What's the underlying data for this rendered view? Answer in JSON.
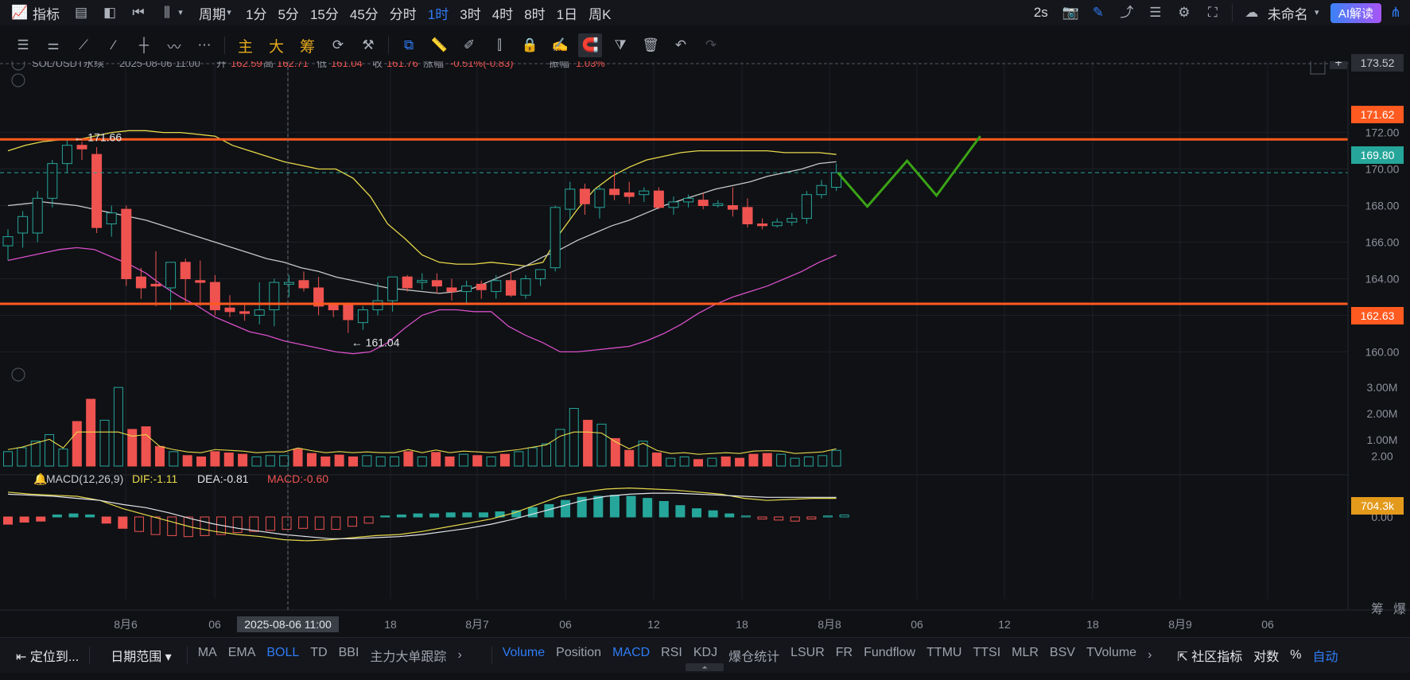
{
  "topbar": {
    "indicator_label": "指标",
    "period_label": "周期",
    "intervals": [
      "1分",
      "5分",
      "15分",
      "45分",
      "分时",
      "1时",
      "3时",
      "4时",
      "8时",
      "1日",
      "周K"
    ],
    "active_interval": "1时",
    "refresh": "2s",
    "layout_name": "未命名",
    "ai_label": "AI解读"
  },
  "drawbar": {
    "main_label": "主",
    "big_label": "大",
    "chip_label": "筹"
  },
  "legend": {
    "symbol": "SOL/USDT永续",
    "datetime": "2025-08-06 11:00",
    "open_label": "开",
    "open": "162.59",
    "high_label": "高",
    "high": "162.71",
    "low_label": "低",
    "low": "161.04",
    "close_label": "收",
    "close": "161.76",
    "change_label": "涨幅",
    "change": "-0.51%(-0.83)",
    "amp_label": "振幅",
    "amp": "1.03%"
  },
  "macd_legend": {
    "name": "MACD(12,26,9)",
    "dif": "DIF:-1.11",
    "dea": "DEA:-0.81",
    "macd": "MACD:-0.60"
  },
  "annotations": {
    "high_mark": "171.66",
    "low_mark": "161.04",
    "crosshair_time": "2025-08-06 11:00"
  },
  "price_tags": {
    "top": "173.52",
    "resistance": "171.62",
    "current": "169.80",
    "support": "162.63",
    "volume": "704.3k"
  },
  "colors": {
    "up": "#26a69a",
    "down": "#ef5350",
    "resistance": "#ff5a1f",
    "projection": "#3ba316",
    "boll_upper": "#e8d94a",
    "boll_mid": "#c8c8c8",
    "boll_lower": "#d94fc8",
    "current": "#26a69a",
    "volume_tag": "#e39a1b"
  },
  "axis": {
    "bottom_right": [
      "筹",
      "爆"
    ]
  },
  "bottombar": {
    "locate": "定位到...",
    "date_range": "日期范围",
    "main_indicators": [
      "MA",
      "EMA",
      "BOLL",
      "TD",
      "BBI",
      "主力大单跟踪"
    ],
    "active_main": "BOLL",
    "sub_indicators": [
      "Volume",
      "Position",
      "MACD",
      "RSI",
      "KDJ",
      "爆仓统计",
      "LSUR",
      "FR",
      "Fundflow",
      "TTMU",
      "TTSI",
      "MLR",
      "BSV",
      "TVolume"
    ],
    "active_sub": [
      "Volume",
      "MACD"
    ],
    "community": "社区指标",
    "log": "对数",
    "percent": "%",
    "auto": "自动"
  },
  "chart_data": {
    "type": "candlestick",
    "symbol": "SOL/USDT永续",
    "interval": "1时",
    "price_axis_ticks": [
      172.0,
      170.0,
      168.0,
      166.0,
      164.0,
      162.0,
      160.0
    ],
    "price_ylim": [
      158.8,
      174.2
    ],
    "time_axis_labels": [
      "8月6",
      "06",
      "2025-08-06 11:00",
      "18",
      "8月7",
      "06",
      "12",
      "18",
      "8月8",
      "06",
      "12",
      "18",
      "8月9",
      "06"
    ],
    "candles": [
      {
        "o": 165.8,
        "h": 166.7,
        "l": 165.0,
        "c": 166.3
      },
      {
        "o": 166.5,
        "h": 167.7,
        "l": 165.7,
        "c": 167.4
      },
      {
        "o": 166.5,
        "h": 168.8,
        "l": 166.0,
        "c": 168.4
      },
      {
        "o": 168.4,
        "h": 170.5,
        "l": 167.9,
        "c": 170.3
      },
      {
        "o": 170.3,
        "h": 171.66,
        "l": 169.8,
        "c": 171.3
      },
      {
        "o": 171.3,
        "h": 171.5,
        "l": 170.5,
        "c": 171.1
      },
      {
        "o": 170.8,
        "h": 171.2,
        "l": 166.5,
        "c": 166.8
      },
      {
        "o": 167.0,
        "h": 168.0,
        "l": 166.3,
        "c": 167.6
      },
      {
        "o": 167.8,
        "h": 168.0,
        "l": 163.6,
        "c": 164.0
      },
      {
        "o": 164.1,
        "h": 164.6,
        "l": 162.9,
        "c": 163.5
      },
      {
        "o": 163.7,
        "h": 165.5,
        "l": 162.5,
        "c": 163.6
      },
      {
        "o": 163.5,
        "h": 164.9,
        "l": 162.3,
        "c": 164.9
      },
      {
        "o": 164.9,
        "h": 165.1,
        "l": 162.7,
        "c": 164.0
      },
      {
        "o": 163.9,
        "h": 165.0,
        "l": 162.5,
        "c": 163.8
      },
      {
        "o": 163.8,
        "h": 164.2,
        "l": 162.0,
        "c": 162.3
      },
      {
        "o": 162.4,
        "h": 163.1,
        "l": 161.9,
        "c": 162.2
      },
      {
        "o": 162.2,
        "h": 162.6,
        "l": 161.7,
        "c": 162.1
      },
      {
        "o": 162.0,
        "h": 163.8,
        "l": 161.5,
        "c": 162.3
      },
      {
        "o": 162.3,
        "h": 164.0,
        "l": 161.4,
        "c": 163.8
      },
      {
        "o": 163.7,
        "h": 164.2,
        "l": 163.0,
        "c": 163.8
      },
      {
        "o": 163.9,
        "h": 164.4,
        "l": 163.3,
        "c": 163.5
      },
      {
        "o": 163.5,
        "h": 164.1,
        "l": 162.0,
        "c": 162.5
      },
      {
        "o": 162.6,
        "h": 162.7,
        "l": 161.9,
        "c": 162.3
      },
      {
        "o": 162.59,
        "h": 162.71,
        "l": 161.04,
        "c": 161.76
      },
      {
        "o": 161.6,
        "h": 162.5,
        "l": 161.2,
        "c": 162.3
      },
      {
        "o": 162.3,
        "h": 163.8,
        "l": 162.0,
        "c": 162.8
      },
      {
        "o": 162.8,
        "h": 164.1,
        "l": 162.2,
        "c": 164.1
      },
      {
        "o": 164.1,
        "h": 164.2,
        "l": 163.3,
        "c": 163.5
      },
      {
        "o": 163.8,
        "h": 164.3,
        "l": 163.4,
        "c": 163.9
      },
      {
        "o": 163.9,
        "h": 164.3,
        "l": 163.2,
        "c": 163.6
      },
      {
        "o": 163.5,
        "h": 164.0,
        "l": 162.8,
        "c": 163.3
      },
      {
        "o": 163.3,
        "h": 163.9,
        "l": 162.6,
        "c": 163.6
      },
      {
        "o": 163.7,
        "h": 163.9,
        "l": 162.9,
        "c": 163.4
      },
      {
        "o": 163.3,
        "h": 164.2,
        "l": 162.9,
        "c": 163.9
      },
      {
        "o": 163.9,
        "h": 164.4,
        "l": 163.0,
        "c": 163.1
      },
      {
        "o": 163.1,
        "h": 164.2,
        "l": 162.9,
        "c": 164.0
      },
      {
        "o": 164.0,
        "h": 164.5,
        "l": 163.6,
        "c": 164.5
      },
      {
        "o": 164.6,
        "h": 168.0,
        "l": 164.4,
        "c": 167.9
      },
      {
        "o": 167.8,
        "h": 169.3,
        "l": 167.3,
        "c": 168.9
      },
      {
        "o": 168.9,
        "h": 169.2,
        "l": 167.5,
        "c": 168.1
      },
      {
        "o": 167.9,
        "h": 169.1,
        "l": 167.3,
        "c": 168.9
      },
      {
        "o": 168.9,
        "h": 169.9,
        "l": 168.3,
        "c": 168.6
      },
      {
        "o": 168.7,
        "h": 169.3,
        "l": 168.1,
        "c": 168.5
      },
      {
        "o": 168.6,
        "h": 169.0,
        "l": 168.2,
        "c": 168.8
      },
      {
        "o": 168.8,
        "h": 169.0,
        "l": 167.8,
        "c": 167.9
      },
      {
        "o": 167.9,
        "h": 168.5,
        "l": 167.5,
        "c": 168.2
      },
      {
        "o": 168.2,
        "h": 168.6,
        "l": 167.9,
        "c": 168.4
      },
      {
        "o": 168.3,
        "h": 168.7,
        "l": 167.8,
        "c": 168.0
      },
      {
        "o": 168.0,
        "h": 168.3,
        "l": 167.9,
        "c": 168.1
      },
      {
        "o": 168.0,
        "h": 169.0,
        "l": 167.4,
        "c": 167.8
      },
      {
        "o": 167.9,
        "h": 168.4,
        "l": 166.8,
        "c": 167.0
      },
      {
        "o": 167.0,
        "h": 167.3,
        "l": 166.7,
        "c": 166.9
      },
      {
        "o": 166.9,
        "h": 167.3,
        "l": 166.8,
        "c": 167.1
      },
      {
        "o": 167.1,
        "h": 167.6,
        "l": 166.9,
        "c": 167.3
      },
      {
        "o": 167.3,
        "h": 168.8,
        "l": 167.0,
        "c": 168.6
      },
      {
        "o": 168.6,
        "h": 169.4,
        "l": 168.4,
        "c": 169.1
      },
      {
        "o": 169.0,
        "h": 170.3,
        "l": 168.8,
        "c": 169.8
      }
    ],
    "boll_upper": [
      171.0,
      171.3,
      171.5,
      171.6,
      171.6,
      171.8,
      172.0,
      172.1,
      172.1,
      172.0,
      172.0,
      171.9,
      171.8,
      171.3,
      171.0,
      170.7,
      170.4,
      170.2,
      170.0,
      170.0,
      169.5,
      168.5,
      167.0,
      166.2,
      165.3,
      164.9,
      164.8,
      164.8,
      164.9,
      164.8,
      164.7,
      164.9,
      166.5,
      167.8,
      168.9,
      169.6,
      170.1,
      170.5,
      170.7,
      170.9,
      171.0,
      171.0,
      171.0,
      171.0,
      171.0,
      170.9,
      170.9,
      170.9,
      170.8
    ],
    "boll_mid": [
      168.0,
      168.1,
      168.2,
      168.1,
      168.0,
      167.8,
      167.6,
      167.4,
      167.2,
      166.9,
      166.6,
      166.3,
      166.0,
      165.7,
      165.4,
      165.1,
      164.9,
      164.6,
      164.4,
      164.1,
      163.9,
      163.7,
      163.5,
      163.4,
      163.3,
      163.2,
      163.3,
      163.5,
      163.9,
      164.3,
      164.7,
      165.2,
      165.6,
      166.1,
      166.5,
      166.9,
      167.2,
      167.6,
      168.0,
      168.3,
      168.6,
      168.9,
      169.1,
      169.3,
      169.6,
      169.8,
      170.0,
      170.3,
      170.4
    ],
    "boll_lower": [
      165.0,
      165.2,
      165.4,
      165.6,
      165.7,
      165.6,
      165.2,
      164.8,
      164.3,
      163.6,
      163.0,
      162.5,
      161.9,
      161.5,
      161.1,
      160.9,
      160.6,
      160.4,
      160.2,
      160.0,
      159.9,
      160.0,
      160.5,
      161.3,
      162.0,
      162.3,
      162.3,
      162.2,
      162.2,
      161.4,
      160.9,
      160.5,
      160.0,
      160.0,
      160.1,
      160.2,
      160.3,
      160.6,
      161.0,
      161.5,
      162.1,
      162.6,
      163.0,
      163.3,
      163.6,
      164.0,
      164.4,
      164.9,
      165.3
    ],
    "resistance_line": 171.62,
    "support_line": 162.63,
    "current_price": 169.8,
    "projection_path": [
      169.8,
      167.95,
      170.45,
      168.55,
      171.8
    ],
    "volume": [
      0.55,
      0.7,
      0.95,
      1.2,
      0.65,
      1.7,
      2.55,
      1.75,
      3.0,
      1.4,
      1.5,
      0.75,
      0.55,
      0.4,
      0.35,
      0.55,
      0.5,
      0.45,
      0.35,
      0.4,
      0.4,
      0.65,
      0.48,
      0.35,
      0.42,
      0.35,
      0.4,
      0.35,
      0.35,
      0.55,
      0.35,
      0.52,
      0.35,
      0.45,
      0.4,
      0.35,
      0.45,
      0.55,
      0.7,
      0.85,
      1.4,
      2.2,
      1.75,
      1.6,
      1.05,
      0.6,
      0.95,
      0.5,
      0.3,
      0.35,
      0.25,
      0.3,
      0.35,
      0.3,
      0.45,
      0.48,
      0.45,
      0.3,
      0.35,
      0.4,
      0.6
    ],
    "volume_axis_ticks": [
      "3.00M",
      "2.00M",
      "1.00M"
    ],
    "volume_last": "704.3k",
    "macd_hist": [
      -0.35,
      -0.25,
      -0.2,
      0.1,
      0.15,
      0.1,
      -0.3,
      -0.55,
      -0.7,
      -0.85,
      -0.9,
      -0.95,
      -0.9,
      -0.85,
      -0.75,
      -0.7,
      -0.65,
      -0.6,
      -0.55,
      -0.6,
      -0.6,
      -0.45,
      -0.3,
      0.05,
      0.1,
      0.15,
      0.15,
      0.2,
      0.2,
      0.2,
      0.25,
      0.3,
      0.45,
      0.6,
      0.8,
      0.95,
      1.0,
      1.05,
      1.0,
      0.9,
      0.75,
      0.55,
      0.4,
      0.3,
      0.15,
      0.05,
      -0.1,
      -0.15,
      -0.2,
      -0.1,
      0.05,
      0.1
    ],
    "macd_dif": [
      1.2,
      1.1,
      1.05,
      1.0,
      0.8,
      0.4,
      0.1,
      -0.2,
      -0.5,
      -0.7,
      -0.85,
      -0.95,
      -1.1,
      -1.15,
      -1.1,
      -1.0,
      -0.9,
      -0.85,
      -0.7,
      -0.5,
      -0.3,
      -0.1,
      0.2,
      0.6,
      1.0,
      1.2,
      1.35,
      1.4,
      1.35,
      1.3,
      1.2,
      1.1,
      0.9,
      0.8,
      0.85,
      0.9,
      0.9
    ],
    "macd_dea": [
      1.1,
      1.05,
      1.0,
      0.9,
      0.8,
      0.6,
      0.45,
      0.2,
      -0.1,
      -0.35,
      -0.55,
      -0.7,
      -0.85,
      -0.95,
      -1.05,
      -1.05,
      -1.0,
      -0.95,
      -0.85,
      -0.7,
      -0.55,
      -0.35,
      -0.1,
      0.2,
      0.5,
      0.8,
      1.0,
      1.1,
      1.15,
      1.15,
      1.1,
      1.05,
      1.0,
      0.95,
      0.95,
      0.95,
      0.95
    ],
    "macd_axis_ticks": [
      "2.00",
      "0.00"
    ]
  }
}
